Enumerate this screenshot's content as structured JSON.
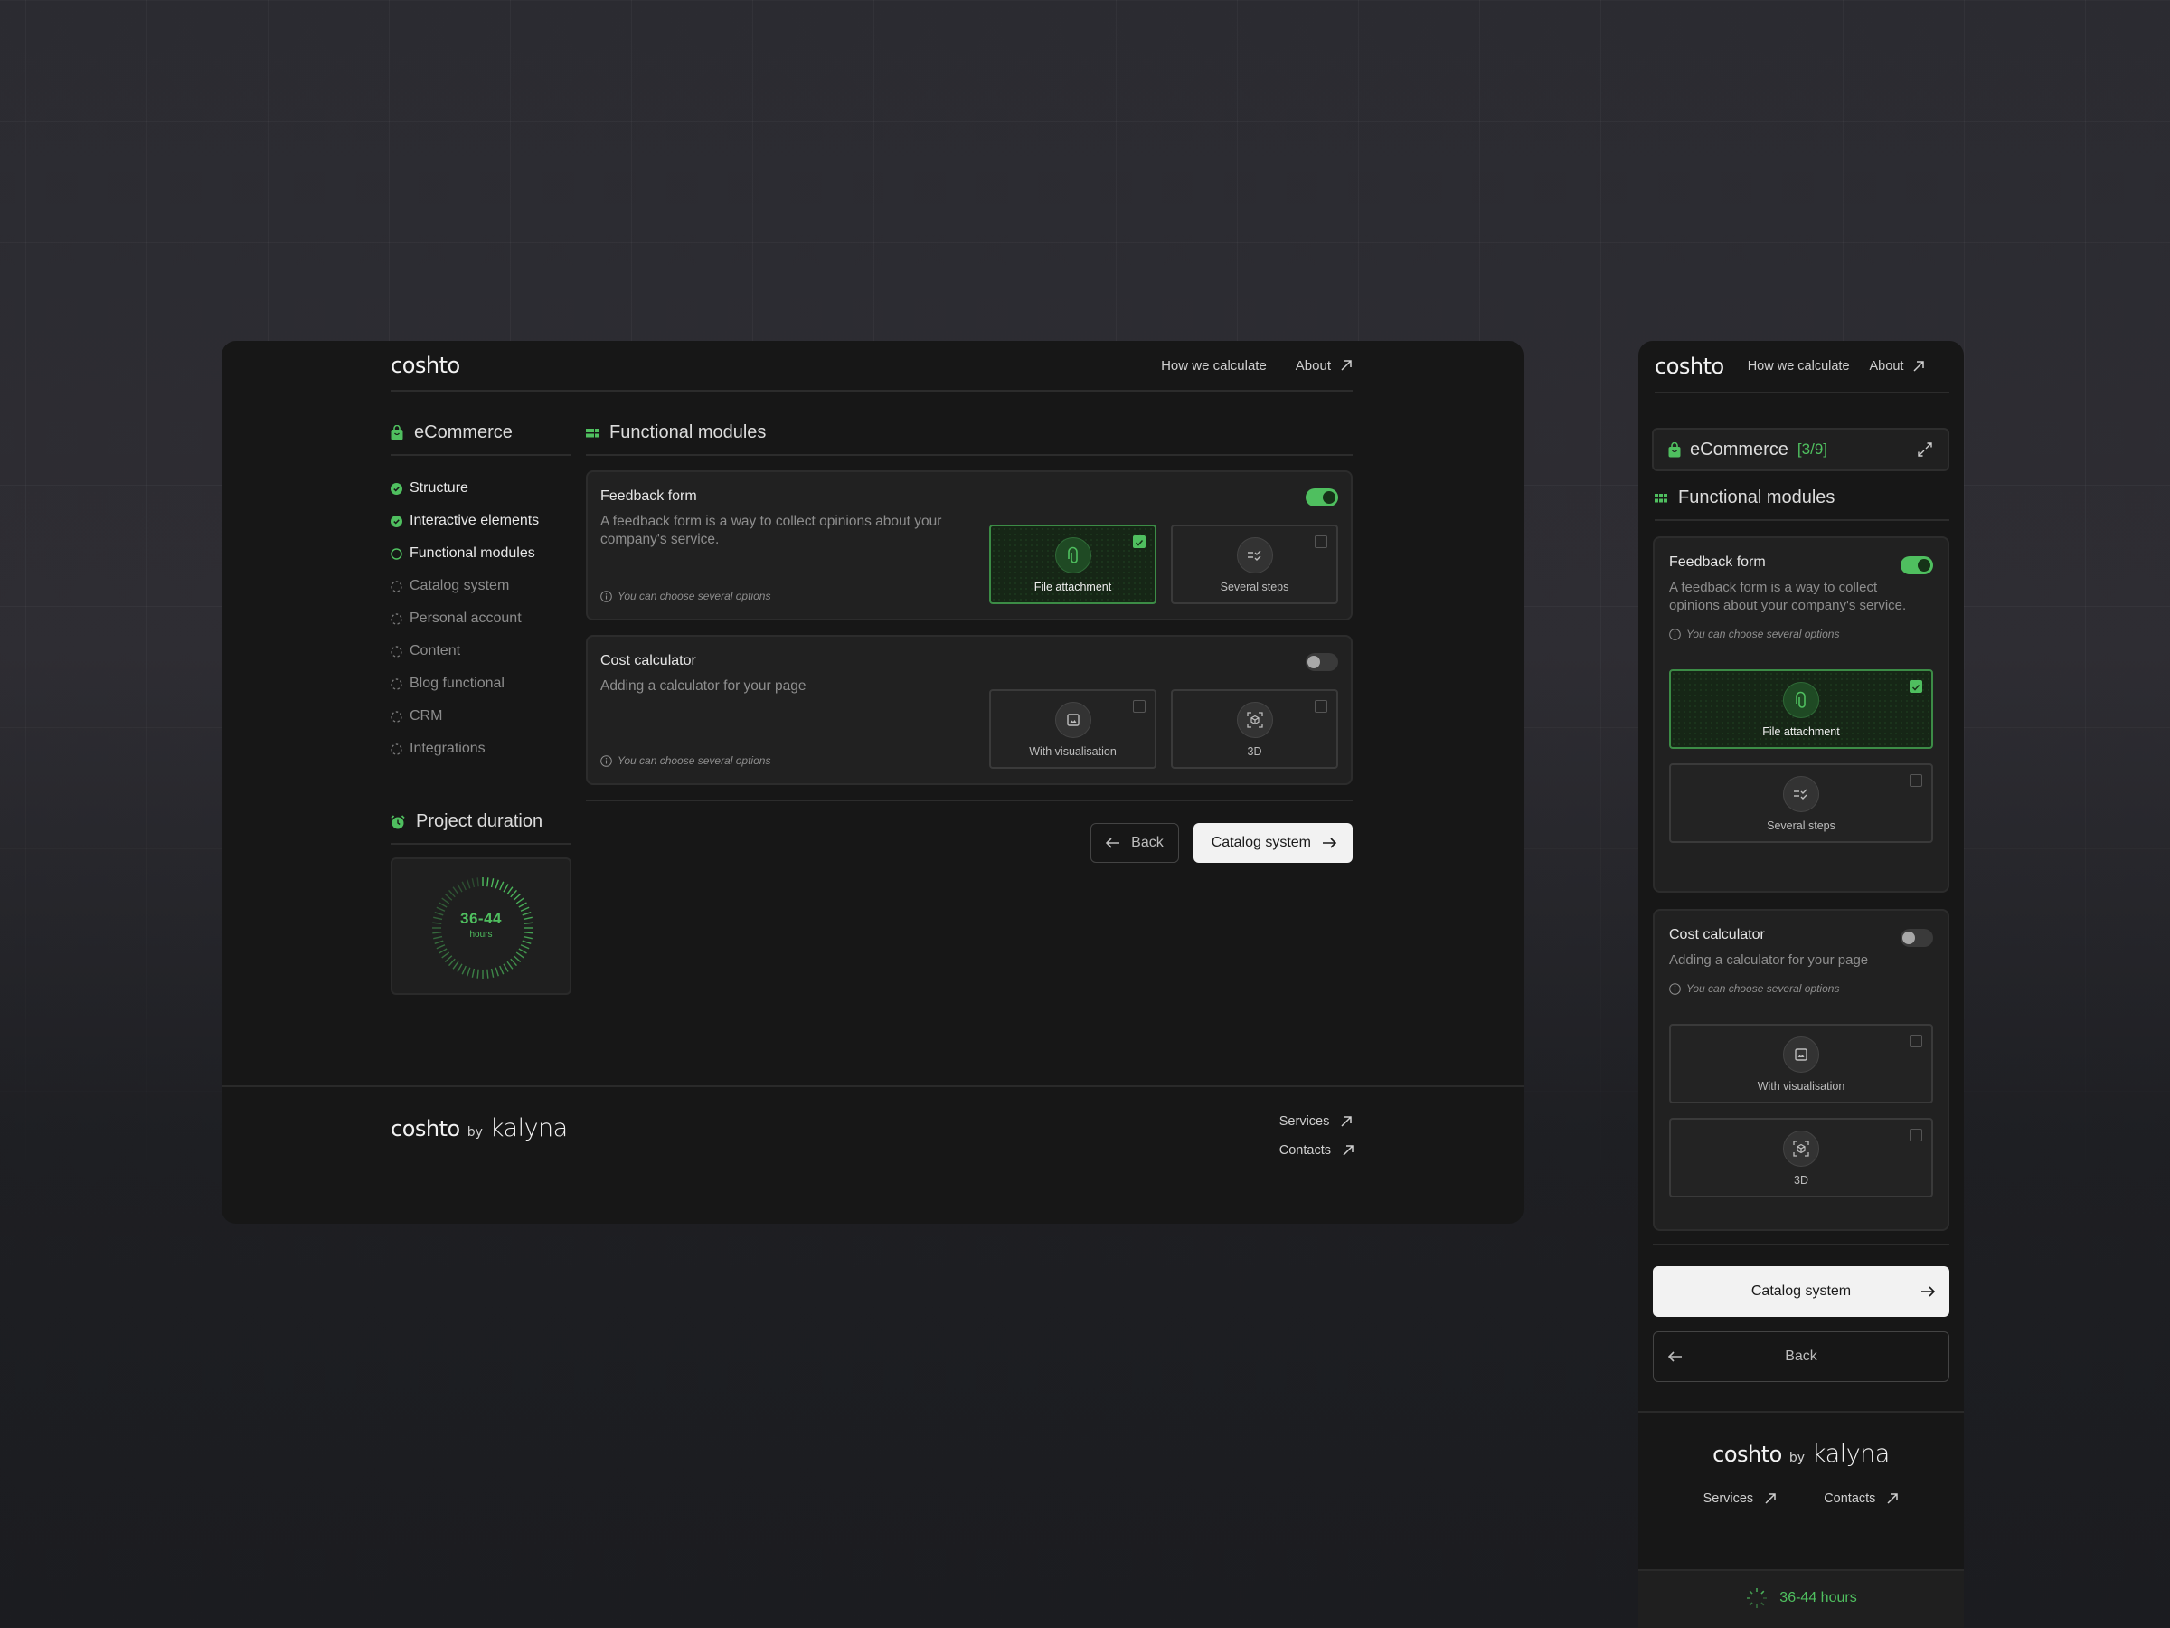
{
  "brand": {
    "logo": "coshto",
    "by": "by",
    "partner": "kalyna"
  },
  "nav": {
    "how_we_calculate": "How we calculate",
    "about": "About"
  },
  "colors": {
    "accent": "#4fbf5f",
    "window_bg": "#171717",
    "card_bg": "#212121",
    "primary_button_bg": "#f2f2f2"
  },
  "category": {
    "title": "eCommerce",
    "progress_label": "[3/9]",
    "completed": 3,
    "total": 9,
    "icon": "shopping-bag-icon"
  },
  "steps": [
    {
      "label": "Structure",
      "status": "done"
    },
    {
      "label": "Interactive elements",
      "status": "done"
    },
    {
      "label": "Functional modules",
      "status": "current"
    },
    {
      "label": "Catalog system",
      "status": "todo"
    },
    {
      "label": "Personal account",
      "status": "todo"
    },
    {
      "label": "Content",
      "status": "todo"
    },
    {
      "label": "Blog functional",
      "status": "todo"
    },
    {
      "label": "CRM",
      "status": "todo"
    },
    {
      "label": "Integrations",
      "status": "todo"
    }
  ],
  "duration": {
    "title": "Project duration",
    "value": "36-44",
    "unit": "hours",
    "combined": "36-44 hours",
    "icon": "alarm-clock-icon"
  },
  "section": {
    "title": "Functional modules",
    "icon": "grid-icon"
  },
  "modules": [
    {
      "title": "Feedback form",
      "enabled": true,
      "description": "A feedback form is a way to collect opinions about your company's service.",
      "hint": "You can choose several options",
      "options": [
        {
          "label": "File attachment",
          "checked": true,
          "icon": "paperclip-icon"
        },
        {
          "label": "Several steps",
          "checked": false,
          "icon": "checklist-icon"
        }
      ]
    },
    {
      "title": "Cost calculator",
      "enabled": false,
      "description": "Adding a calculator for your page",
      "hint": "You can choose several options",
      "options": [
        {
          "label": "With visualisation",
          "checked": false,
          "icon": "image-icon"
        },
        {
          "label": "3D",
          "checked": false,
          "icon": "3d-cube-icon"
        }
      ]
    }
  ],
  "actions": {
    "back": "Back",
    "next": "Catalog system"
  },
  "footer": {
    "services": "Services",
    "contacts": "Contacts"
  }
}
